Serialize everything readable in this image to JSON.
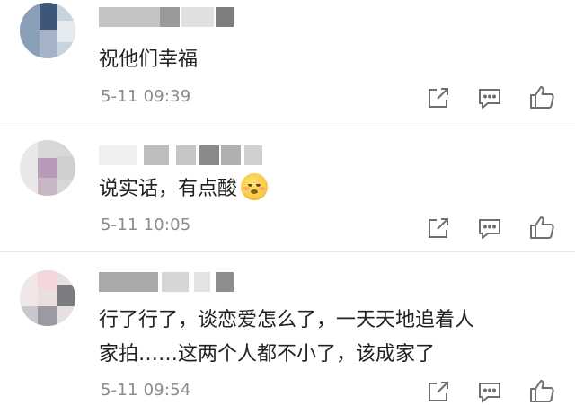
{
  "comments": [
    {
      "text": "祝他们幸福",
      "timestamp": "5-11 09:39"
    },
    {
      "text": "说实话，有点酸",
      "emoji": "grimace-emoji",
      "timestamp": "5-11 10:05"
    },
    {
      "text_line1": "行了行了，谈恋爱怎么了，一天天地追着人",
      "text_line2": "家拍……这两个人都不小了，该成家了",
      "timestamp": "5-11 09:54"
    }
  ],
  "actions": {
    "share_icon": "share-icon",
    "reply_icon": "reply-icon",
    "like_icon": "thumbs-up-icon"
  },
  "colors": {
    "text": "#222222",
    "timestamp": "#8a8a8a",
    "icon": "#6f6f6f",
    "divider": "#e6e6e6"
  }
}
